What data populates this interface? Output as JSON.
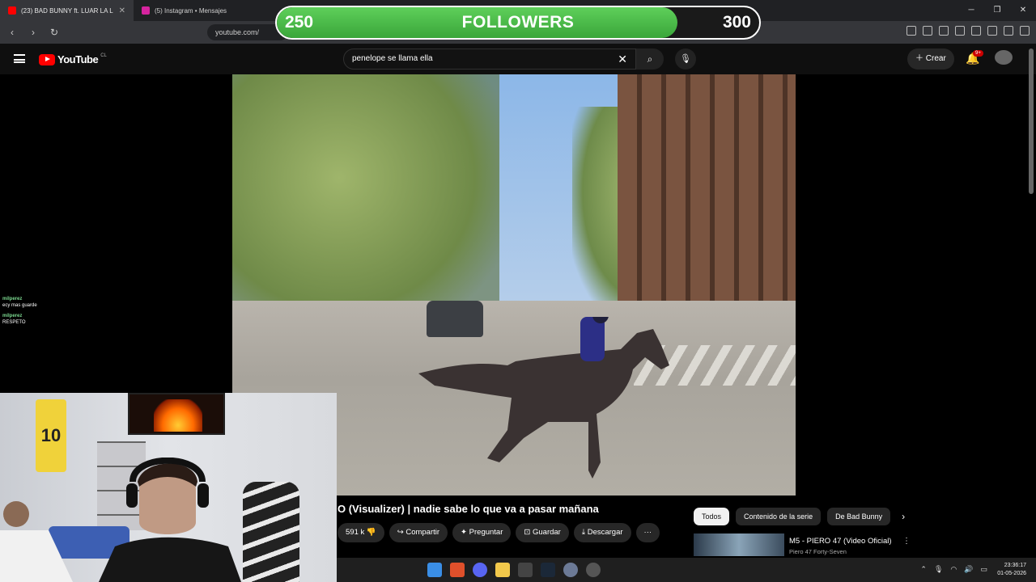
{
  "browser": {
    "tabs": [
      {
        "label": "(23) BAD BUNNY ft. LUAR LA L",
        "active": true,
        "favicon_color": "#ff0000"
      },
      {
        "label": "(5) Instagram • Mensajes",
        "active": false,
        "favicon_color": "#d6249f"
      }
    ],
    "url": "youtube.com/"
  },
  "followers_goal": {
    "current": "250",
    "label": "FOLLOWERS",
    "target": "300",
    "progress_fraction": 0.83,
    "bar_color": "#4cbb47"
  },
  "youtube": {
    "logo_text": "YouTube",
    "country_code": "CL",
    "search_value": "penelope se llama ella",
    "create_label": "Crear",
    "notifications_badge": "9+"
  },
  "video": {
    "title": "O (Visualizer) | nadie sabe lo que va a pasar mañana",
    "actions": {
      "likes": "591 k",
      "share": "Compartir",
      "ask": "Preguntar",
      "save": "Guardar",
      "download": "Descargar",
      "more": "···"
    }
  },
  "chips": [
    "Todos",
    "Contenido de la serie",
    "De Bad Bunny"
  ],
  "related": {
    "title": "M5 - PIERO 47 (Video Oficial)",
    "channel": "Piero 47 Forty-Seven"
  },
  "chat": [
    {
      "user": "milperez",
      "message": "ecy mas guarde"
    },
    {
      "user": "milperez",
      "message": "RESPETO"
    }
  ],
  "webcam": {
    "jersey_number": "10"
  },
  "taskbar": {
    "time": "23:36:17",
    "date": "01-05-2026"
  }
}
